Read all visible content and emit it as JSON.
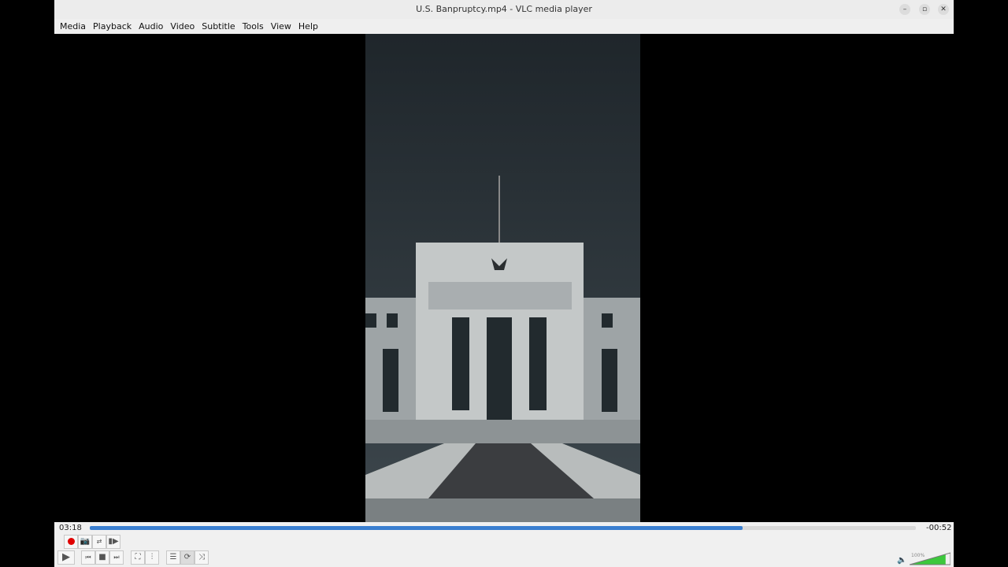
{
  "window": {
    "title": "U.S. Banpruptcy.mp4 - VLC media player"
  },
  "menu": [
    "Media",
    "Playback",
    "Audio",
    "Video",
    "Subtitle",
    "Tools",
    "View",
    "Help"
  ],
  "player": {
    "elapsed": "03:18",
    "remaining": "-00:52",
    "progress_fraction": 0.79,
    "volume_label": "100%",
    "volume_fraction": 1.0
  },
  "colors": {
    "accent": "#3a7fd0",
    "record": "#e00000",
    "volume": "#3cc83c"
  }
}
